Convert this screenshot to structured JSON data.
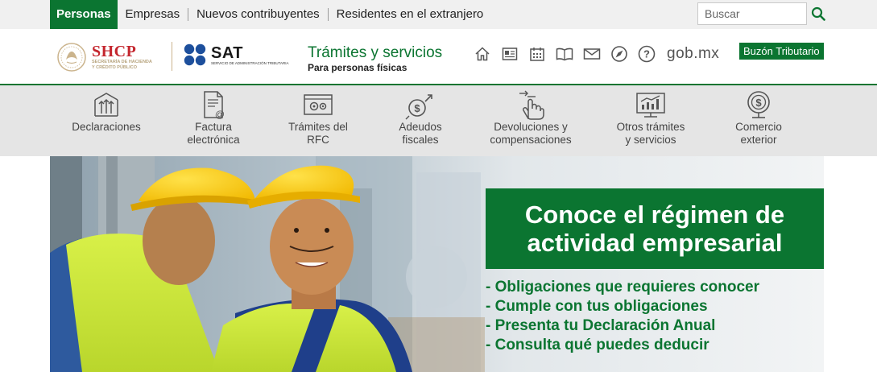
{
  "topnav": {
    "items": [
      {
        "label": "Personas",
        "active": true
      },
      {
        "label": "Empresas",
        "active": false
      },
      {
        "label": "Nuevos contribuyentes",
        "active": false
      },
      {
        "label": "Residentes en el extranjero",
        "active": false
      }
    ]
  },
  "search": {
    "placeholder": "Buscar",
    "value": "",
    "icon": "search-icon"
  },
  "header": {
    "shcp_name": "SHCP",
    "shcp_sub_1": "SECRETARÍA DE HACIENDA",
    "shcp_sub_2": "Y CRÉDITO PÚBLICO",
    "sat_name": "SAT",
    "sat_sub": "SERVICIO DE ADMINISTRACIÓN TRIBUTARIA",
    "title": "Trámites y servicios",
    "subtitle": "Para personas físicas",
    "icons": [
      "home-icon",
      "newspaper-icon",
      "calendar-icon",
      "book-icon",
      "mail-icon",
      "compass-icon",
      "help-icon"
    ],
    "gobmx": "gob.mx",
    "buzon": "Buzón Tributario"
  },
  "services": [
    {
      "line1": "Declaraciones",
      "line2": "",
      "icon": "declaraciones-icon"
    },
    {
      "line1": "Factura",
      "line2": "electrónica",
      "icon": "factura-icon"
    },
    {
      "line1": "Trámites del",
      "line2": "RFC",
      "icon": "rfc-icon"
    },
    {
      "line1": "Adeudos",
      "line2": "fiscales",
      "icon": "adeudos-icon"
    },
    {
      "line1": "Devoluciones y",
      "line2": "compensaciones",
      "icon": "devoluciones-icon"
    },
    {
      "line1": "Otros trámites",
      "line2": "y servicios",
      "icon": "otros-tramites-icon"
    },
    {
      "line1": "Comercio",
      "line2": "exterior",
      "icon": "comercio-icon"
    }
  ],
  "hero": {
    "heading_1": "Conoce el régimen de",
    "heading_2": "actividad empresarial",
    "items": [
      "- Obligaciones que requieres conocer",
      "- Cumple con tus obligaciones",
      "- Presenta tu Declaración Anual",
      "- Consulta qué puedes deducir"
    ]
  },
  "colors": {
    "brand_green": "#0b7531",
    "shcp_red": "#c4262e",
    "sat_blue": "#1d4f9c",
    "gold": "#cbb48d"
  }
}
